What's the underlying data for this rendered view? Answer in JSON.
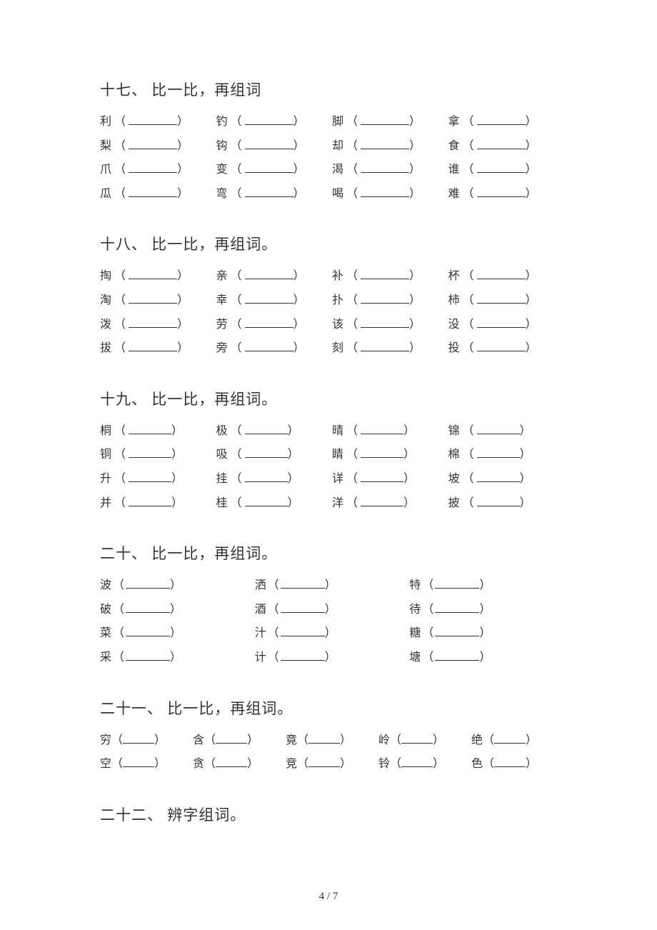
{
  "pageNumber": "4 / 7",
  "sections": [
    {
      "title": "十七、 比一比，再组词",
      "style": "c4 wide",
      "blankClass": "b58",
      "rows": [
        [
          "利",
          "钓",
          "脚",
          "拿"
        ],
        [
          "梨",
          "钩",
          "却",
          "食"
        ],
        [
          "爪",
          "变",
          "渴",
          "谁"
        ],
        [
          "瓜",
          "弯",
          "喝",
          "难"
        ]
      ]
    },
    {
      "title": "十八、 比一比，再组词。",
      "style": "c4 wide",
      "blankClass": "b58",
      "rows": [
        [
          "掏",
          "亲",
          "补",
          "杯"
        ],
        [
          "淘",
          "幸",
          "扑",
          "柿"
        ],
        [
          "泼",
          "劳",
          "该",
          "没"
        ],
        [
          "拔",
          "旁",
          "刻",
          "投"
        ]
      ]
    },
    {
      "title": "十九、 比一比，再组词。",
      "style": "c4 wide",
      "blankClass": "b54",
      "rows": [
        [
          "桐",
          "极",
          "晴",
          "锦"
        ],
        [
          "铜",
          "吸",
          "睛",
          "棉"
        ],
        [
          "升",
          "挂",
          "详",
          "坡"
        ],
        [
          "并",
          "桂",
          "洋",
          "披"
        ]
      ]
    },
    {
      "title": "二十、 比一比，再组词。",
      "style": "c3",
      "blankClass": "b56",
      "rows": [
        [
          "波",
          "洒",
          "特"
        ],
        [
          "破",
          "酒",
          "待"
        ],
        [
          "菜",
          "汁",
          "糖"
        ],
        [
          "采",
          "计",
          "塘"
        ]
      ]
    },
    {
      "title": "二十一、 比一比，再组词。",
      "style": "c5",
      "blankClass": "b46",
      "rows": [
        [
          "穷",
          "含",
          "竟",
          "岭",
          "绝"
        ],
        [
          "空",
          "贪",
          "竞",
          "铃",
          "色"
        ]
      ]
    },
    {
      "title": "二十二、 辨字组词。",
      "style": "c4",
      "blankClass": "b58",
      "rows": []
    }
  ]
}
